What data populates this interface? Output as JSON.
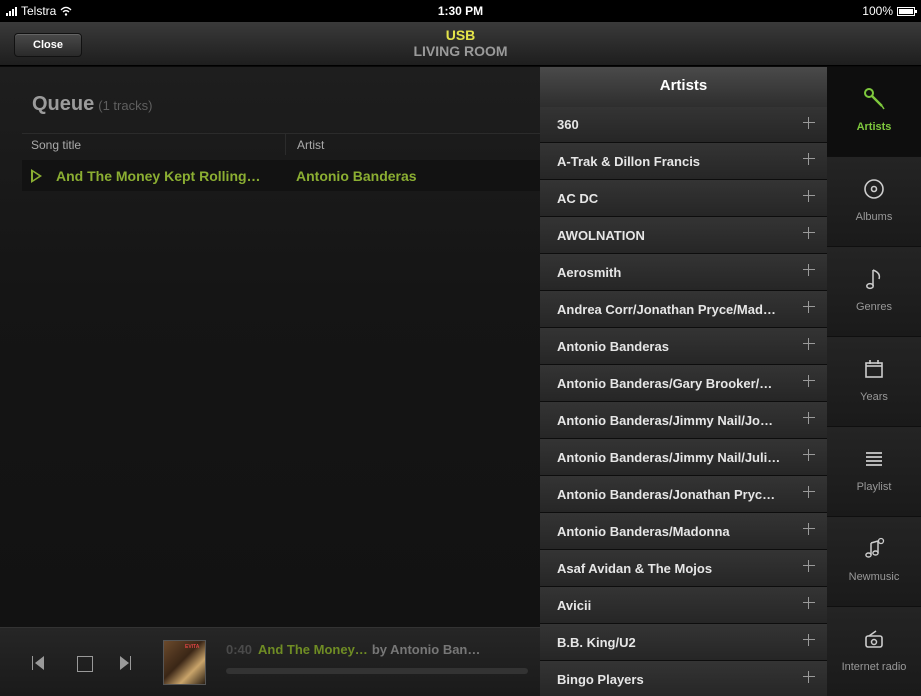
{
  "status": {
    "carrier": "Telstra",
    "time": "1:30 PM",
    "battery": "100%"
  },
  "nav": {
    "close_label": "Close",
    "source": "USB",
    "room": "LIVING ROOM"
  },
  "queue": {
    "title": "Queue",
    "count": "(1 tracks)",
    "columns": [
      "Song title",
      "Artist"
    ],
    "rows": [
      {
        "song": "And The Money Kept Rolling…",
        "artist": "Antonio Banderas"
      }
    ]
  },
  "player": {
    "elapsed": "0:40",
    "song": "And The Money…",
    "by": "by Antonio Ban…",
    "album_text": "EVITA",
    "progress": 0.0
  },
  "panel": {
    "title": "Artists",
    "artists": [
      "360",
      "A-Trak & Dillon Francis",
      "AC DC",
      "AWOLNATION",
      "Aerosmith",
      "Andrea Corr/Jonathan Pryce/Mad…",
      "Antonio Banderas",
      "Antonio Banderas/Gary Brooker/…",
      "Antonio Banderas/Jimmy Nail/Jo…",
      "Antonio Banderas/Jimmy Nail/Juli…",
      "Antonio Banderas/Jonathan Pryc…",
      "Antonio Banderas/Madonna",
      "Asaf Avidan & The Mojos",
      "Avicii",
      "B.B. King/U2",
      "Bingo Players"
    ]
  },
  "tabs": [
    {
      "label": "Artists",
      "icon": "microphone-icon",
      "active": true
    },
    {
      "label": "Albums",
      "icon": "disc-icon",
      "active": false
    },
    {
      "label": "Genres",
      "icon": "music-note-icon",
      "active": false
    },
    {
      "label": "Years",
      "icon": "calendar-icon",
      "active": false
    },
    {
      "label": "Playlist",
      "icon": "list-icon",
      "active": false
    },
    {
      "label": "Newmusic",
      "icon": "new-music-icon",
      "active": false
    },
    {
      "label": "Internet radio",
      "icon": "radio-icon",
      "active": false
    }
  ],
  "colors": {
    "accent_green": "#7ec83d",
    "source_yellow": "#e4e44a",
    "queue_green": "#8bae32"
  }
}
